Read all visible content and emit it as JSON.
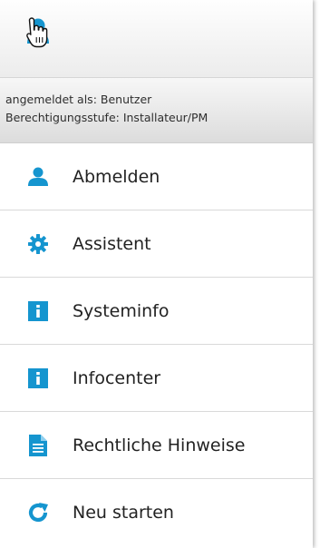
{
  "user_button": {
    "icon": "user-icon",
    "cursor": "hand-pointer-cursor"
  },
  "info": {
    "logged_in_as": "angemeldet als: Benutzer",
    "permission_level": "Berechtigungsstufe: Installateur/PM"
  },
  "menu": {
    "items": [
      {
        "label": "Abmelden",
        "icon": "user-icon"
      },
      {
        "label": "Assistent",
        "icon": "gear-icon"
      },
      {
        "label": "Systeminfo",
        "icon": "info-icon"
      },
      {
        "label": "Infocenter",
        "icon": "info-icon"
      },
      {
        "label": "Rechtliche Hinweise",
        "icon": "document-icon"
      },
      {
        "label": "Neu starten",
        "icon": "refresh-icon"
      }
    ]
  },
  "colors": {
    "accent": "#1595cf"
  }
}
